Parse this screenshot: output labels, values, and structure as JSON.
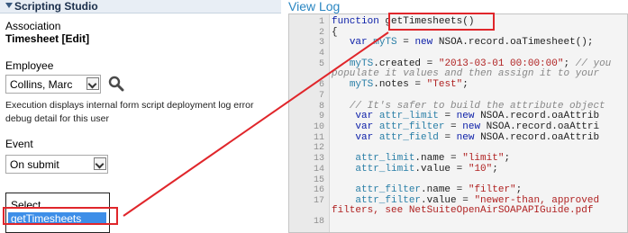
{
  "sidebar": {
    "title": "Scripting Studio",
    "association_label": "Association",
    "association_value": "Timesheet [Edit]",
    "employee_label": "Employee",
    "employee_value": "Collins, Marc",
    "execution_note": "Execution displays internal form script deployment log error debug detail for this user",
    "event_label": "Event",
    "event_value": "On submit",
    "function_list": [
      "Select...",
      "getTimesheets"
    ],
    "selected_function": "getTimesheets"
  },
  "right": {
    "view_log_label": "View Log"
  },
  "code": {
    "lines": [
      {
        "n": "1",
        "html": "<span class=\"kw\">function</span> getTimesheets()"
      },
      {
        "n": "2",
        "html": "{"
      },
      {
        "n": "3",
        "html": "   <span class=\"kw\">var</span> <span class=\"var\">myTS</span> = <span class=\"kw\">new</span> NSOA.record.oaTimesheet();"
      },
      {
        "n": "4",
        "html": ""
      },
      {
        "n": "5",
        "html": "   <span class=\"var\">myTS</span>.created = <span class=\"str\">\"2013-03-01 00:00:00\"</span>; <span class=\"cmt\">// you</span>"
      },
      {
        "n": "",
        "html": "<span class=\"cmt\">populate it values and then assign it to your</span>"
      },
      {
        "n": "6",
        "html": "   <span class=\"var\">myTS</span>.notes = <span class=\"str\">\"Test\"</span>;"
      },
      {
        "n": "7",
        "html": ""
      },
      {
        "n": "8",
        "html": "   <span class=\"cmt\">// It's safer to build the attribute object</span>"
      },
      {
        "n": "9",
        "html": "    <span class=\"kw\">var</span> <span class=\"var\">attr_limit</span> = <span class=\"kw\">new</span> NSOA.record.oaAttrib"
      },
      {
        "n": "10",
        "html": "    <span class=\"kw\">var</span> <span class=\"var\">attr_filter</span> = <span class=\"kw\">new</span> NSOA.record.oaAttri"
      },
      {
        "n": "11",
        "html": "    <span class=\"kw\">var</span> <span class=\"var\">attr_field</span> = <span class=\"kw\">new</span> NSOA.record.oaAttrib"
      },
      {
        "n": "12",
        "html": ""
      },
      {
        "n": "13",
        "html": "    <span class=\"var\">attr_limit</span>.name = <span class=\"str\">\"limit\"</span>;"
      },
      {
        "n": "14",
        "html": "    <span class=\"var\">attr_limit</span>.value = <span class=\"str\">\"10\"</span>;"
      },
      {
        "n": "15",
        "html": ""
      },
      {
        "n": "16",
        "html": "    <span class=\"var\">attr_filter</span>.name = <span class=\"str\">\"filter\"</span>;"
      },
      {
        "n": "17",
        "html": "    <span class=\"var\">attr_filter</span>.value = <span class=\"str\">\"newer-than, approved</span>"
      },
      {
        "n": "",
        "html": "<span class=\"str\">filters, see NetSuiteOpenAirSOAPAPIGuide.pdf</span>"
      },
      {
        "n": "18",
        "html": ""
      }
    ]
  },
  "colors": {
    "highlight_red": "#e0262b",
    "selection_blue": "#3d8ee8",
    "link_blue": "#2a86c2"
  }
}
